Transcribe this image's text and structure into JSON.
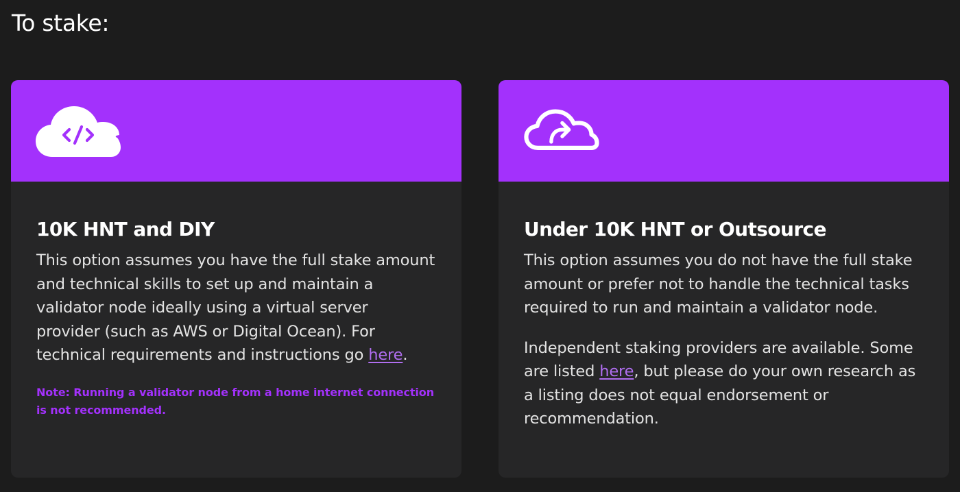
{
  "page": {
    "title": "To stake:"
  },
  "colors": {
    "background": "#1c1c1c",
    "card": "#262627",
    "accent": "#a331fc",
    "link": "#b06ef0"
  },
  "cards": [
    {
      "icon": "cloud-code-icon",
      "heading": "10K HNT and DIY",
      "paragraph_1_before_link": "This option assumes you have the full stake amount and technical skills to set up and maintain a validator node ideally using a virtual server provider (such as AWS or Digital Ocean). For technical requirements and instructions go ",
      "link_label": "here",
      "paragraph_1_after_link": ".",
      "note": "Note: Running a validator node from a home internet connection is not recommended."
    },
    {
      "icon": "cloud-forward-icon",
      "heading": "Under 10K HNT or Outsource",
      "paragraph_1": "This option assumes you do not have the full stake amount or prefer not to handle the technical tasks required to run and maintain a validator node.",
      "paragraph_2_before_link": "Independent staking providers are available. Some are listed ",
      "link_label": "here",
      "paragraph_2_after_link": ", but please do your own research as a listing does not equal endorsement or recommendation."
    }
  ]
}
